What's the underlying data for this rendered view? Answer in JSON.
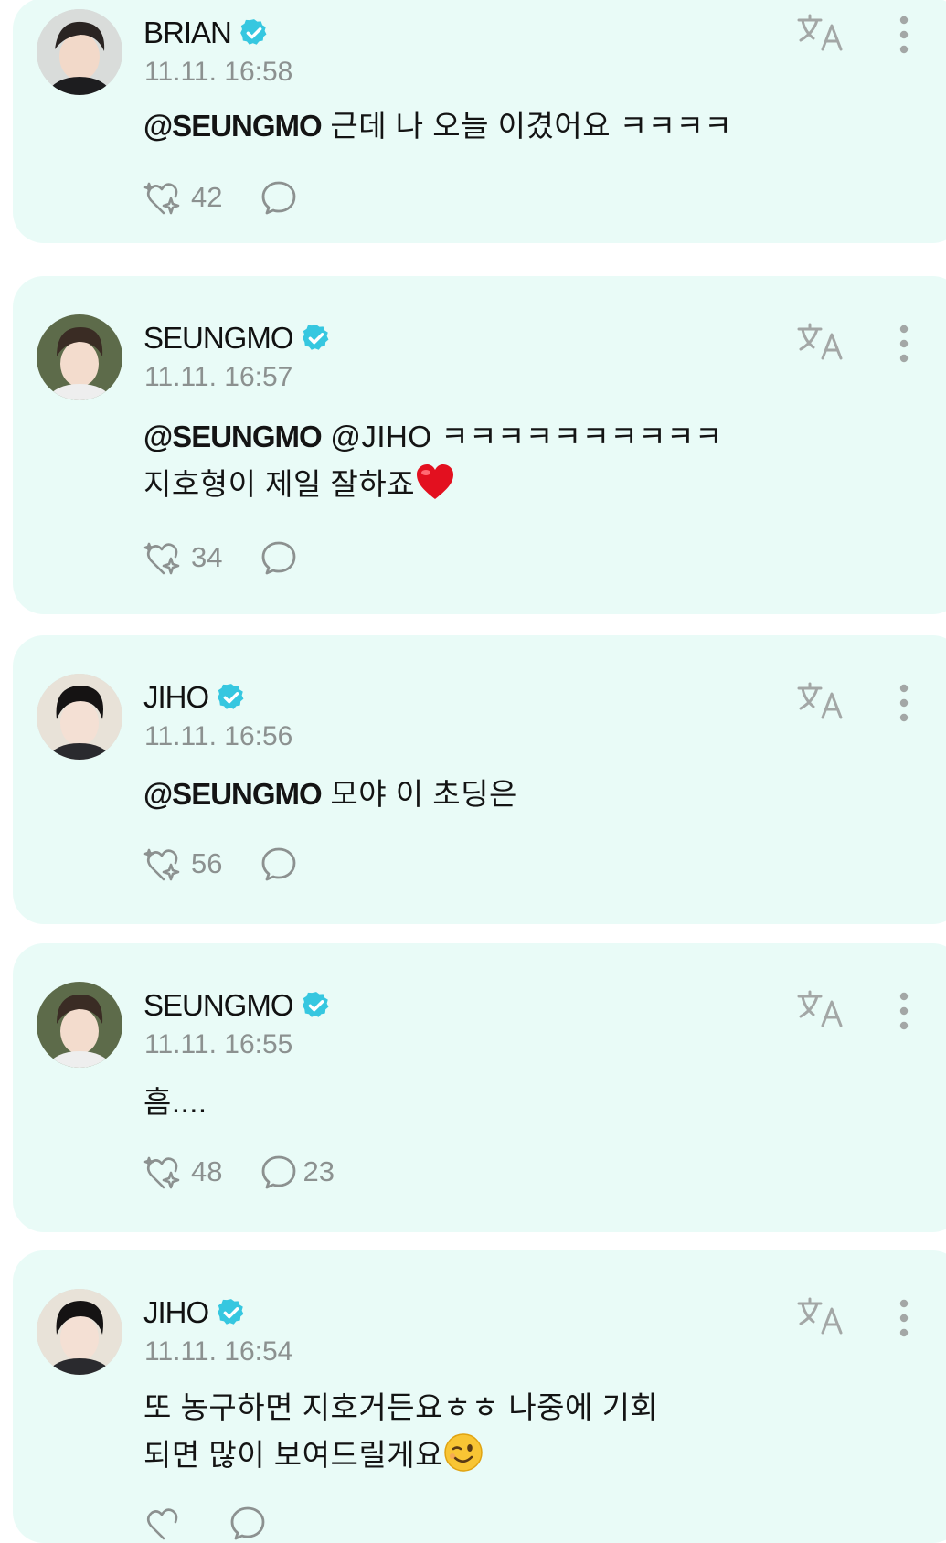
{
  "colors": {
    "card_bg": "#e9fbf7",
    "verified": "#36c7e0",
    "text": "#141414",
    "muted": "#8c9190"
  },
  "posts": [
    {
      "author": "BRIAN",
      "verified": true,
      "time": "11.11. 16:58",
      "mention": "@SEUNGMO",
      "text_line1": " 근데 나 오늘 이겼어요 ㅋㅋㅋㅋ",
      "text_line2": "",
      "likes": "42",
      "comments": ""
    },
    {
      "author": "SEUNGMO",
      "verified": true,
      "time": "11.11. 16:57",
      "mention": "@SEUNGMO",
      "text_line1": " @JIHO ㅋㅋㅋㅋㅋㅋㅋㅋㅋㅋ",
      "text_line2": "지호형이 제일 잘하죠",
      "line2_emoji": "red-heart",
      "likes": "34",
      "comments": ""
    },
    {
      "author": "JIHO",
      "verified": true,
      "time": "11.11. 16:56",
      "mention": "@SEUNGMO",
      "text_line1": " 모야 이 초딩은",
      "text_line2": "",
      "likes": "56",
      "comments": ""
    },
    {
      "author": "SEUNGMO",
      "verified": true,
      "time": "11.11. 16:55",
      "mention": "",
      "text_line1": "흠....",
      "text_line2": "",
      "likes": "48",
      "comments": "23"
    },
    {
      "author": "JIHO",
      "verified": true,
      "time": "11.11. 16:54",
      "mention": "",
      "text_line1": "또 농구하면 지호거든요ㅎㅎ 나중에 기회",
      "text_line2": "되면 많이 보여드릴게요",
      "line2_emoji": "winking-face",
      "likes": "",
      "comments": ""
    }
  ],
  "icons": {
    "translate": "translate-icon",
    "more": "more-vertical-icon",
    "like": "sparkle-heart-icon",
    "comment": "comment-bubble-icon",
    "verified": "verified-badge-icon"
  }
}
